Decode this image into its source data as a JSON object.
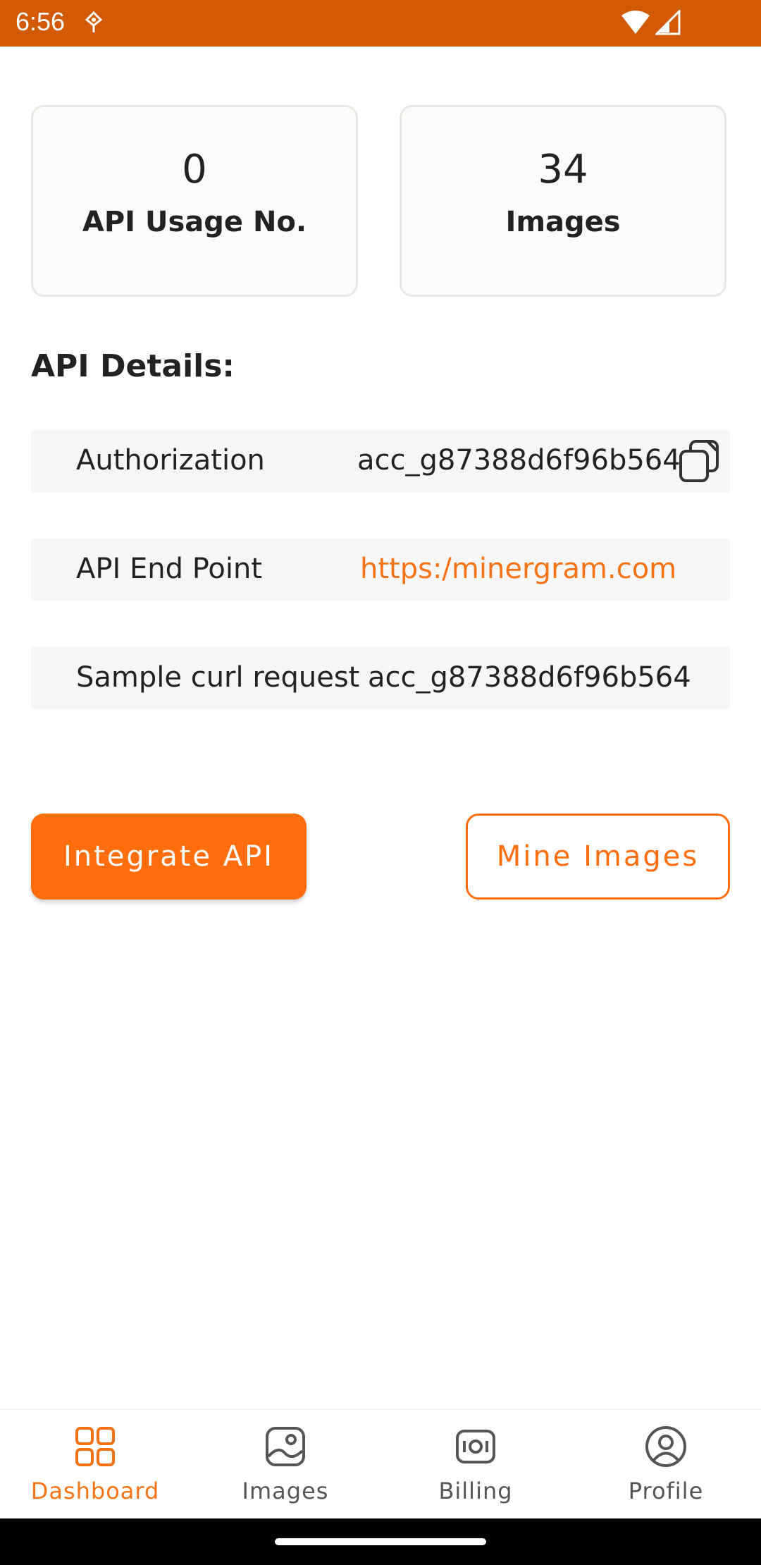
{
  "status_bar": {
    "time": "6:56",
    "background_color": "#d35a05",
    "icons": [
      "notification-icon",
      "wifi-icon",
      "cell-signal-icon"
    ]
  },
  "stats": [
    {
      "value": "0",
      "label": "API Usage No."
    },
    {
      "value": "34",
      "label": "Images"
    }
  ],
  "api_details": {
    "title": "API Details:",
    "rows": [
      {
        "key": "Authorization",
        "value": "acc_g87388d6f96b564",
        "icon": "copy-icon"
      },
      {
        "key": "API End Point",
        "value": "https:/minergram.com"
      },
      {
        "key": "Sample curl request",
        "value": "acc_g87388d6f96b564"
      }
    ]
  },
  "actions": {
    "primary_label": "Integrate API",
    "secondary_label": "Mine Images"
  },
  "bottom_nav": {
    "active": "Dashboard",
    "items": [
      {
        "label": "Dashboard",
        "icon": "dashboard-grid-icon"
      },
      {
        "label": "Images",
        "icon": "image-icon"
      },
      {
        "label": "Billing",
        "icon": "billing-icon"
      },
      {
        "label": "Profile",
        "icon": "profile-icon"
      }
    ]
  },
  "colors": {
    "accent": "#ff6d0d",
    "link": "#f57315",
    "card_bg": "#fdfbf9",
    "row_bg": "#f6f6f6"
  }
}
